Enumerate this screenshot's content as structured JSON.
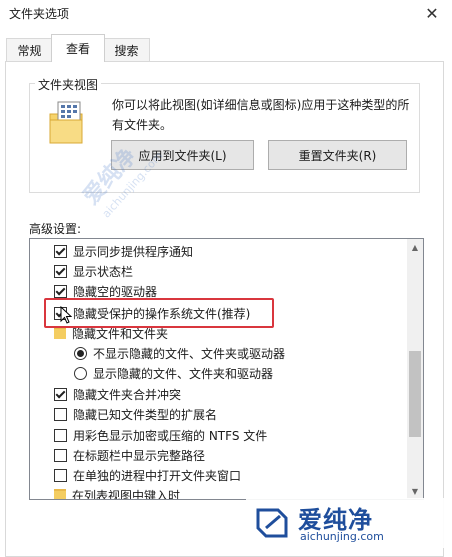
{
  "window": {
    "title": "文件夹选项",
    "close_glyph": "✕"
  },
  "tabs": [
    {
      "label": "常规",
      "active": false
    },
    {
      "label": "查看",
      "active": true
    },
    {
      "label": "搜索",
      "active": false
    }
  ],
  "folder_views": {
    "legend": "文件夹视图",
    "description": "你可以将此视图(如详细信息或图标)应用于这种类型的所有文件夹。",
    "apply_button": "应用到文件夹(L)",
    "reset_button": "重置文件夹(R)"
  },
  "advanced": {
    "label": "高级设置:",
    "items": [
      {
        "type": "checkbox",
        "checked": true,
        "label": "显示同步提供程序通知"
      },
      {
        "type": "checkbox",
        "checked": true,
        "label": "显示状态栏"
      },
      {
        "type": "checkbox",
        "checked": true,
        "label": "隐藏空的驱动器"
      },
      {
        "type": "checkbox",
        "checked": true,
        "label": "隐藏受保护的操作系统文件(推荐)"
      },
      {
        "type": "folder",
        "label": "隐藏文件和文件夹"
      },
      {
        "type": "radio",
        "selected": true,
        "label": "不显示隐藏的文件、文件夹或驱动器"
      },
      {
        "type": "radio",
        "selected": false,
        "label": "显示隐藏的文件、文件夹和驱动器"
      },
      {
        "type": "checkbox",
        "checked": true,
        "label": "隐藏文件夹合并冲突"
      },
      {
        "type": "checkbox",
        "checked": false,
        "label": "隐藏已知文件类型的扩展名"
      },
      {
        "type": "checkbox",
        "checked": false,
        "label": "用彩色显示加密或压缩的 NTFS 文件"
      },
      {
        "type": "checkbox",
        "checked": false,
        "label": "在标题栏中显示完整路径"
      },
      {
        "type": "checkbox",
        "checked": false,
        "label": "在单独的进程中打开文件夹窗口"
      },
      {
        "type": "folder",
        "label": "在列表视图中键入时"
      }
    ]
  },
  "watermark": {
    "title": "爱纯净",
    "url": "aichunjing.com",
    "center_title": "爱纯净",
    "center_url": "aichunjing.com"
  },
  "colors": {
    "highlight_border": "#d9363e",
    "watermark_blue": "#1f4e9c",
    "folder_yellow": "#f4cd61"
  }
}
